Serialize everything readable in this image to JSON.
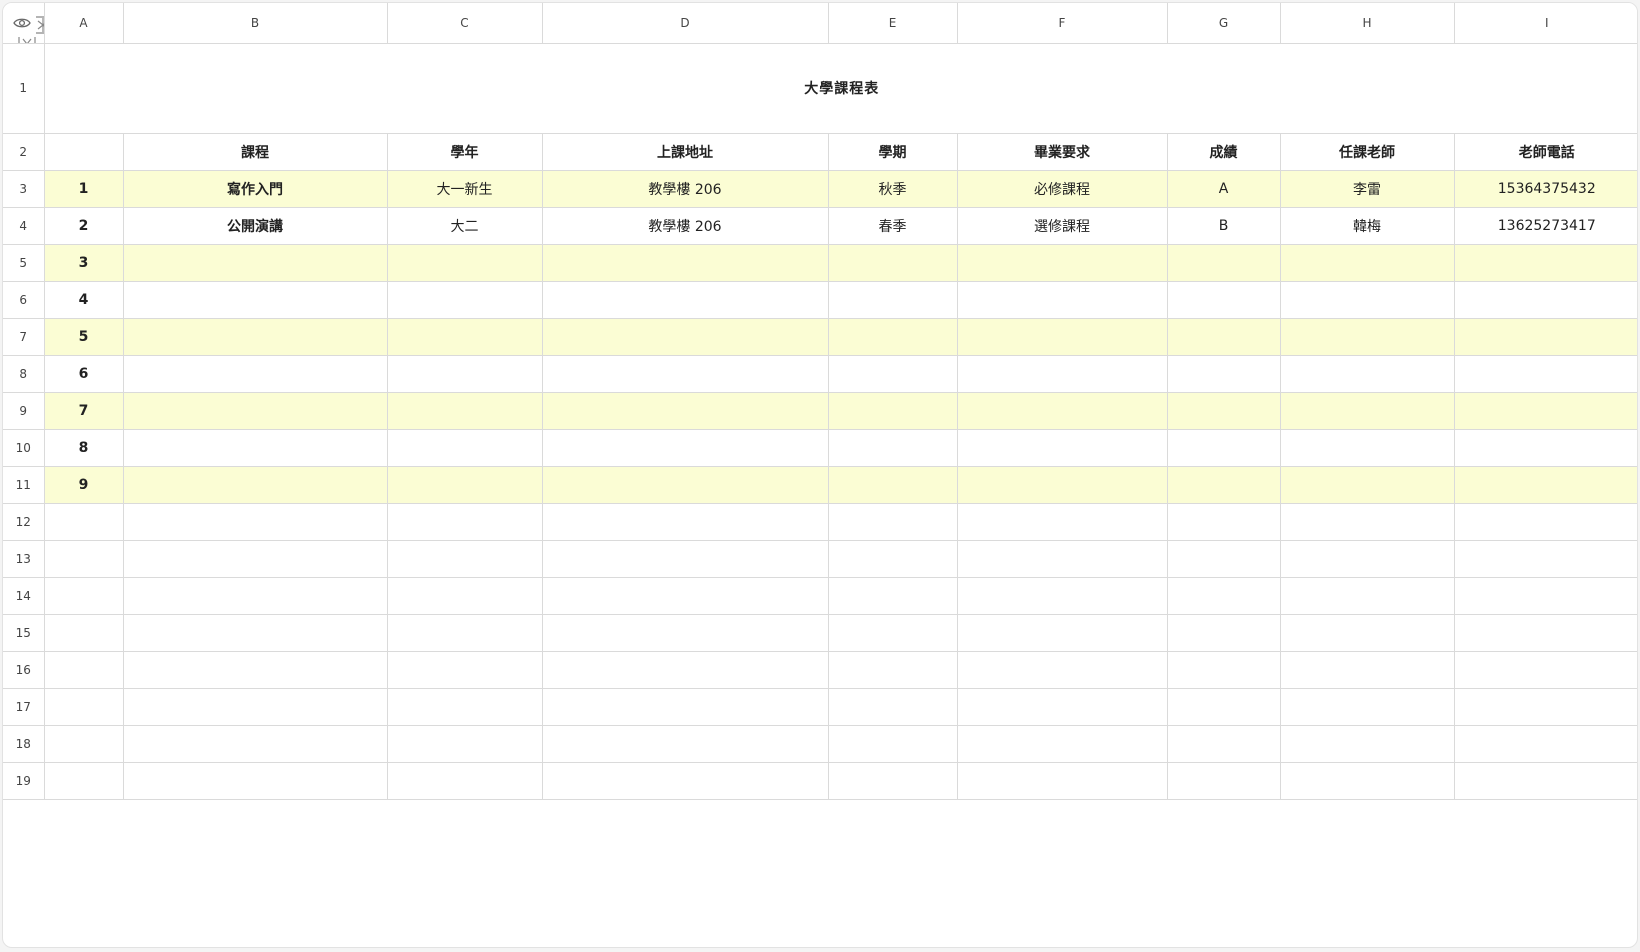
{
  "columns": [
    "A",
    "B",
    "C",
    "D",
    "E",
    "F",
    "G",
    "H",
    "I"
  ],
  "rows": [
    "1",
    "2",
    "3",
    "4",
    "5",
    "6",
    "7",
    "8",
    "9",
    "10",
    "11",
    "12",
    "13",
    "14",
    "15",
    "16",
    "17",
    "18",
    "19"
  ],
  "title": "大學課程表",
  "headers": {
    "course": "課程",
    "year": "學年",
    "address": "上課地址",
    "semester": "學期",
    "requirement": "畢業要求",
    "grade": "成績",
    "teacher": "任課老師",
    "phone": "老師電話"
  },
  "records": [
    {
      "index": "1",
      "course": "寫作入門",
      "year": "大一新生",
      "address": "教學樓 206",
      "semester": "秋季",
      "requirement": "必修課程",
      "grade": "A",
      "teacher": "李雷",
      "phone": "15364375432"
    },
    {
      "index": "2",
      "course": "公開演講",
      "year": "大二",
      "address": "教學樓 206",
      "semester": "春季",
      "requirement": "選修課程",
      "grade": "B",
      "teacher": "韓梅",
      "phone": "13625273417"
    },
    {
      "index": "3"
    },
    {
      "index": "4"
    },
    {
      "index": "5"
    },
    {
      "index": "6"
    },
    {
      "index": "7"
    },
    {
      "index": "8"
    },
    {
      "index": "9"
    }
  ],
  "colors": {
    "band": "#fbfdd4",
    "grid_line": "#dadada",
    "text": "#222222"
  },
  "icons": [
    "eye-icon",
    "freeze-columns-icon",
    "freeze-rows-icon"
  ]
}
